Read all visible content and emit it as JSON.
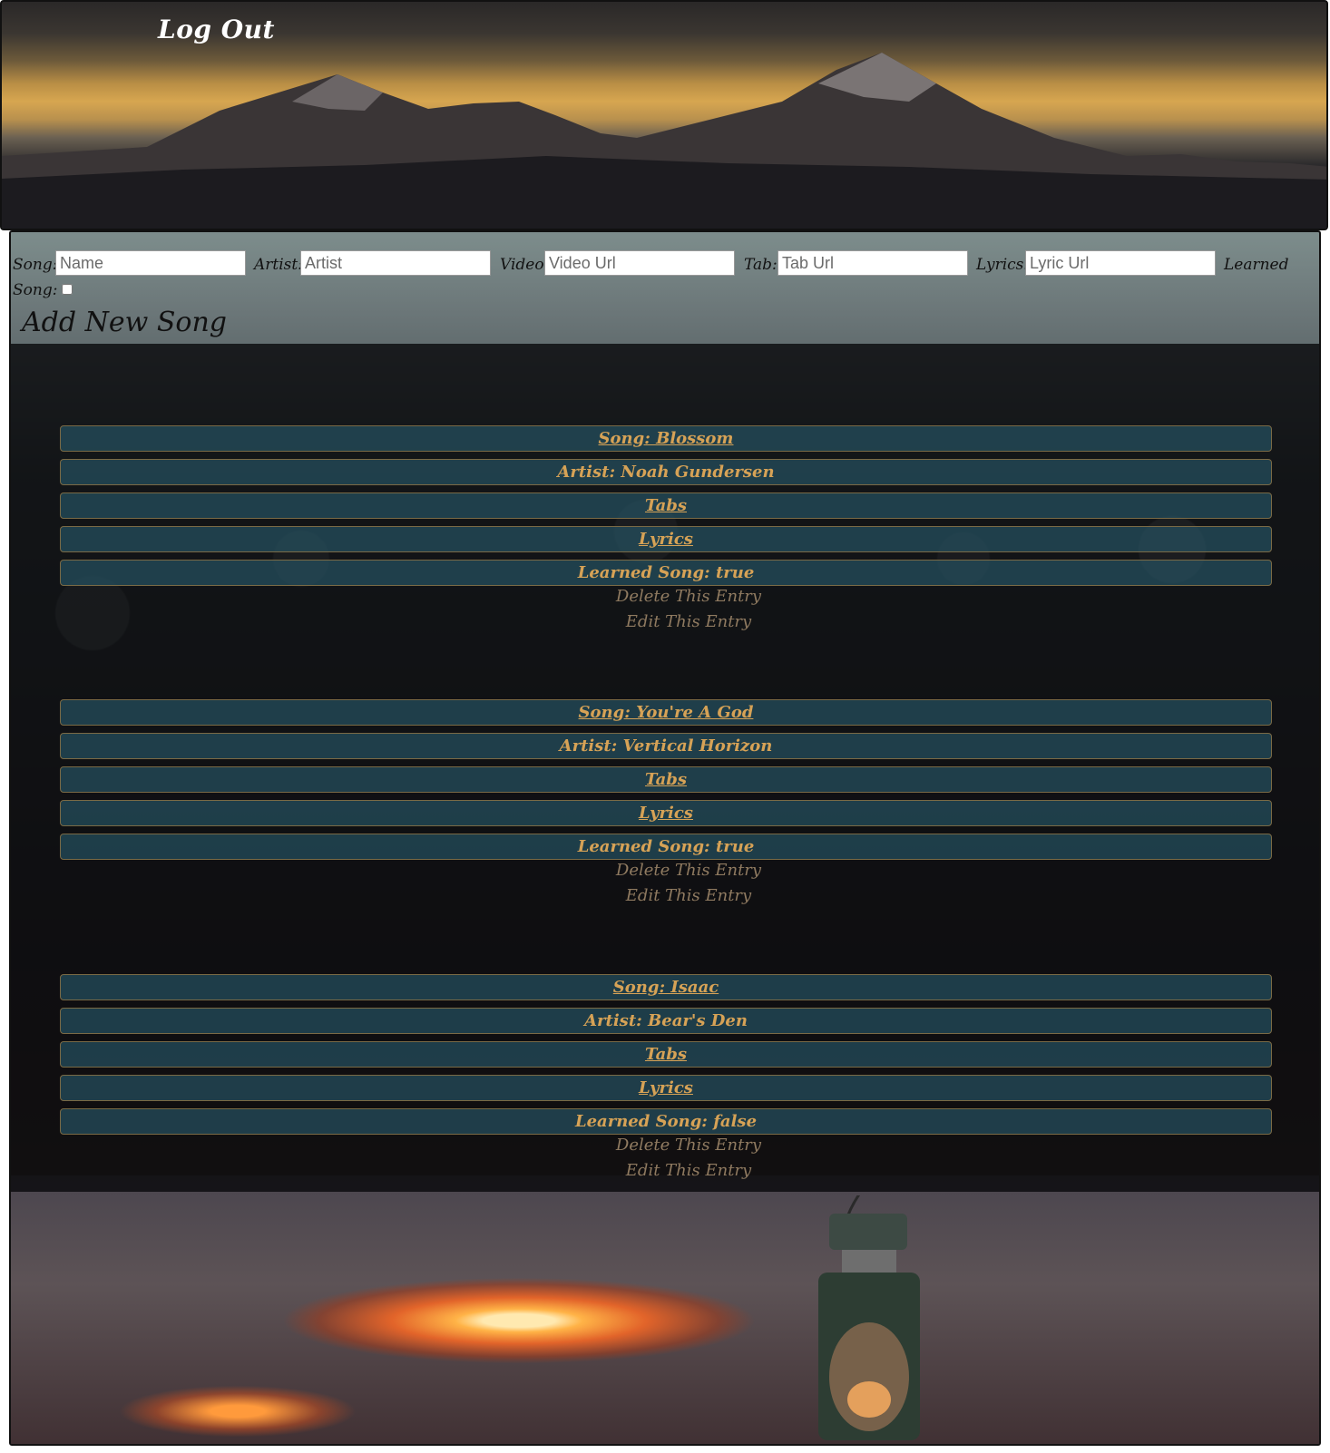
{
  "header": {
    "logout_label": "Log Out"
  },
  "form": {
    "song_label": "Song:",
    "song_placeholder": "Name",
    "artist_label": "Artist:",
    "artist_placeholder": "Artist",
    "video_label": "Video:",
    "video_placeholder": "Video Url",
    "tab_label": "Tab:",
    "tab_placeholder": "Tab Url",
    "lyrics_label": "Lyrics:",
    "lyrics_placeholder": "Lyric Url",
    "learned_label_line1": "Learned",
    "learned_label_line2": "Song:",
    "learned_checked": false,
    "add_button": "Add New Song"
  },
  "songs": [
    {
      "song": "Song: Blossom",
      "artist": "Artist: Noah Gundersen",
      "tabs": "Tabs",
      "lyrics": "Lyrics",
      "learned": "Learned Song: true",
      "delete": "Delete This Entry",
      "edit": "Edit This Entry"
    },
    {
      "song": "Song: You're A God",
      "artist": "Artist: Vertical Horizon",
      "tabs": "Tabs",
      "lyrics": "Lyrics",
      "learned": "Learned Song: true",
      "delete": "Delete This Entry",
      "edit": "Edit This Entry"
    },
    {
      "song": "Song: Isaac",
      "artist": "Artist: Bear's Den",
      "tabs": "Tabs",
      "lyrics": "Lyrics",
      "learned": "Learned Song: false",
      "delete": "Delete This Entry",
      "edit": "Edit This Entry"
    }
  ],
  "colors": {
    "bar_background": "#265464",
    "bar_text": "#d6a256",
    "action_text": "#8f7a60"
  }
}
